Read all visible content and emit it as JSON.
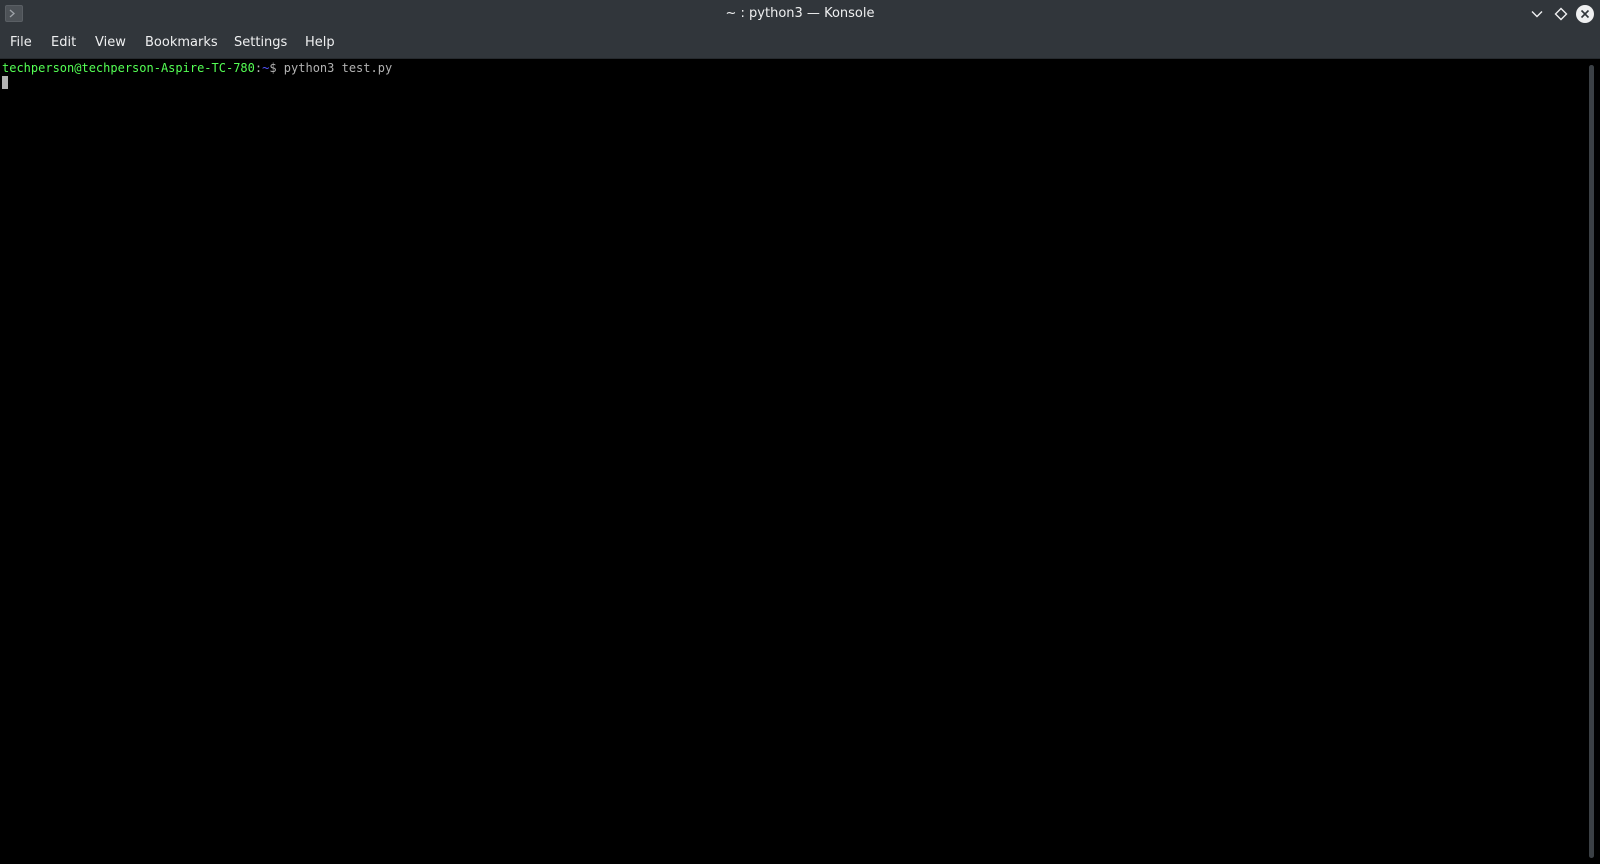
{
  "window": {
    "title": "~ : python3 — Konsole",
    "app_icon": "konsole-terminal-icon",
    "controls": {
      "minimize_icon": "chevron-down-icon",
      "maximize_icon": "diamond-icon",
      "close_icon": "close-icon"
    }
  },
  "menu": {
    "file": "File",
    "edit": "Edit",
    "view": "View",
    "bookmarks": "Bookmarks",
    "settings": "Settings",
    "help": "Help"
  },
  "terminal": {
    "prompt_user_host": "techperson@techperson-Aspire-TC-780",
    "prompt_separator": ":",
    "prompt_path": "~",
    "prompt_symbol": "$",
    "command": " python3 test.py"
  },
  "colors": {
    "titlebar_bg": "#31363b",
    "terminal_bg": "#000000",
    "prompt_user": "#54ff54",
    "prompt_path": "#5454ff",
    "text": "#b2b2b2"
  }
}
